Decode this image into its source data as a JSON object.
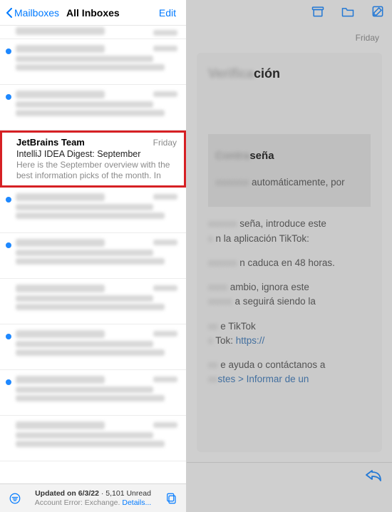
{
  "nav": {
    "back_label": "Mailboxes",
    "title": "All Inboxes",
    "edit_label": "Edit"
  },
  "messages": [
    {
      "sender": "Southwest",
      "date": "",
      "subject": "",
      "preview": "",
      "unread": false,
      "blur": true,
      "truncated_top": true
    },
    {
      "sender": "Facebook mentions",
      "date": "Friday",
      "subject": "Someone tagged you on Facebook",
      "preview": "You have new activity waiting.",
      "unread": true,
      "blur": true
    },
    {
      "sender": "Twitter",
      "date": "Friday",
      "subject": "New direct message",
      "preview": "Someone sent you a message.",
      "unread": true,
      "blur": true
    },
    {
      "sender": "JetBrains Team",
      "date": "Friday",
      "subject": "IntelliJ IDEA Digest: September",
      "preview": "Here is the September overview with the best information picks of the month. In ad...",
      "unread": false,
      "blur": false,
      "highlight": true
    },
    {
      "sender": "Pocket",
      "date": "Friday",
      "subject": "Life on Amazon",
      "preview": "The week's best reads.",
      "unread": true,
      "blur": true
    },
    {
      "sender": "Twitter",
      "date": "Friday",
      "subject": "Your timeline recap",
      "preview": "See what you missed from people you follow.",
      "unread": true,
      "blur": true
    },
    {
      "sender": "LinkedIn Job Alerts",
      "date": "Thursday",
      "subject": "5 new jobs for 'Producer, Writer'",
      "preview": "Based on your profile and search history.",
      "unread": false,
      "blur": true
    },
    {
      "sender": "LinkedIn Job Alerts",
      "date": "Thursday",
      "subject": "New jobs in United Kingdom",
      "preview": "Apply now to roles matching your alerts.",
      "unread": true,
      "blur": true
    },
    {
      "sender": "Samsung Electronics",
      "date": "Thursday",
      "subject": "Special offer just for you",
      "preview": "Save on Galaxy devices this week.",
      "unread": true,
      "blur": true
    },
    {
      "sender": "Twitter",
      "date": "Thursday",
      "subject": "Your highlights",
      "preview": "Top posts from your network.",
      "unread": false,
      "blur": true
    }
  ],
  "footer": {
    "updated_line": "Updated on 6/3/22",
    "unread_line": "5,101 Unread",
    "error_label": "Account Error: Exchange.",
    "details_label": "Details..."
  },
  "detail": {
    "date": "Friday",
    "heading_suffix": "ción",
    "section_heading": "seña",
    "para1_suffix": "automáticamente, por",
    "para2a_suffix": "seña, introduce este",
    "para2b_suffix": "n la aplicación TikTok:",
    "para3_suffix": "n caduca en 48 horas.",
    "para4a_suffix": "ambio, ignora este",
    "para4b_suffix": "a seguirá siendo la",
    "sig1_suffix": "e TikTok",
    "sig2_suffix": "Tok: ",
    "sig2_link": "https://",
    "help1_suffix": "e ayuda o contáctanos a",
    "help2_suffix": "stes > Informar de un"
  }
}
